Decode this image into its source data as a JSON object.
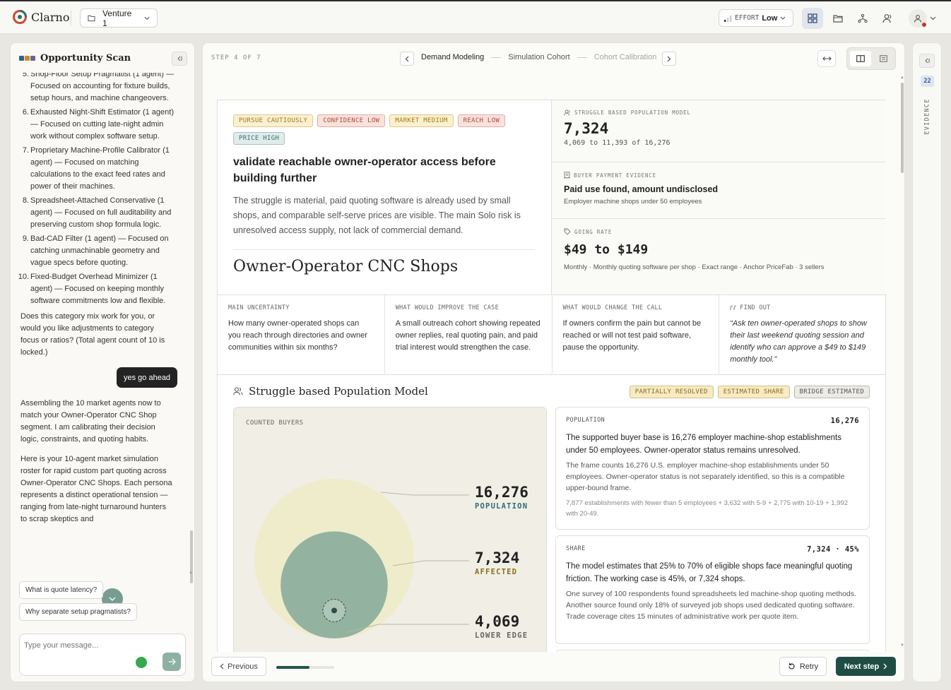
{
  "app": {
    "name": "Clarno",
    "venture": "Venture 1",
    "effort_label": "EFFORT",
    "effort_value": "Low"
  },
  "colors": {
    "accent": "#1f4d44",
    "bubble_population": "#efeccc",
    "bubble_affected": "#93b3a0",
    "chart_bg": "#f1eee5"
  },
  "left_panel": {
    "title": "Opportunity Scan",
    "list": [
      {
        "n": "5.",
        "text": "Shop-Floor Setup Pragmatist (1 agent) — Focused on accounting for fixture builds, setup hours, and machine changeovers."
      },
      {
        "n": "6.",
        "text": "Exhausted Night-Shift Estimator (1 agent) — Focused on cutting late-night admin work without complex software setup."
      },
      {
        "n": "7.",
        "text": "Proprietary Machine-Profile Calibrator (1 agent) — Focused on matching calculations to the exact feed rates and power of their machines."
      },
      {
        "n": "8.",
        "text": "Spreadsheet-Attached Conservative (1 agent) — Focused on full auditability and preserving custom shop formula logic."
      },
      {
        "n": "9.",
        "text": "Bad-CAD Filter (1 agent) — Focused on catching unmachinable geometry and vague specs before quoting."
      },
      {
        "n": "10.",
        "text": "Fixed-Budget Overhead Minimizer (1 agent) — Focused on keeping monthly software commitments low and flexible."
      }
    ],
    "question": "Does this category mix work for you, or would you like adjustments to category focus or ratios? (Total agent count of 10 is locked.)",
    "user_message": "yes go ahead",
    "reply1": "Assembling the 10 market agents now to match your Owner-Operator CNC Shop segment. I am calibrating their decision logic, constraints, and quoting habits.",
    "reply2": "Here is your 10-agent market simulation roster for rapid custom part quoting across Owner-Operator CNC Shops. Each persona represents a distinct operational tension — ranging from late-night turnaround hunters to scrap skeptics and",
    "chips": [
      "What is quote latency?",
      "Why separate setup pragmatists?"
    ],
    "composer_placeholder": "Type your message..."
  },
  "stepper": {
    "step_label": "STEP 4 OF 7",
    "steps": [
      "Demand Modeling",
      "Simulation Cohort",
      "Cohort Calibration"
    ]
  },
  "verdict": {
    "tags": [
      {
        "text": "PURSUE CAUTIOUSLY",
        "color": "#a4791b",
        "bg": "#fbf1cf"
      },
      {
        "text": "CONFIDENCE LOW",
        "color": "#b14a3a",
        "bg": "#f9e2dc"
      },
      {
        "text": "MARKET MEDIUM",
        "color": "#a4791b",
        "bg": "#fbf1cf"
      },
      {
        "text": "REACH LOW",
        "color": "#b14a3a",
        "bg": "#f9e2dc"
      },
      {
        "text": "PRICE HIGH",
        "color": "#3e6e72",
        "bg": "#dfecea"
      }
    ],
    "headline": "validate reachable owner-operator access before building further",
    "body": "The struggle is material, paid quoting software is already used by small shops, and comparable self-serve prices are visible. The main Solo risk is unresolved access supply, not lack of commercial demand.",
    "segment": "Owner-Operator CNC Shops"
  },
  "metrics": {
    "population": {
      "label": "STRUGGLE BASED POPULATION MODEL",
      "value": "7,324",
      "range": "4,069 to 11,393 of 16,276"
    },
    "payment": {
      "label": "BUYER PAYMENT EVIDENCE",
      "headline": "Paid use found, amount undisclosed",
      "sub": "Employer machine shops under 50 employees"
    },
    "rate": {
      "label": "GOING RATE",
      "value": "$49 to $149",
      "sub": "Monthly · Monthly quoting software per shop · Exact range · Anchor PriceFab · 3 sellers"
    }
  },
  "insights": [
    {
      "label": "MAIN UNCERTAINTY",
      "text": "How many owner-operated shops can you reach through directories and owner communities within six months?"
    },
    {
      "label": "WHAT WOULD IMPROVE THE CASE",
      "text": "A small outreach cohort showing repeated owner replies, real quoting pain, and paid trial interest would strengthen the case."
    },
    {
      "label": "WHAT WOULD CHANGE THE CALL",
      "text": "If owners confirm the pain but cannot be reached or will not test paid software, pause the opportunity."
    },
    {
      "label": "FIND OUT",
      "text": "“Ask ten owner-operated shops to show their last weekend quoting session and identify who can approve a $49 to $149 monthly tool.”"
    }
  ],
  "population_model": {
    "title": "Struggle based Population Model",
    "tags": [
      {
        "text": "PARTIALLY RESOLVED",
        "color": "#8c6a17",
        "bg": "#f6ebc4"
      },
      {
        "text": "ESTIMATED SHARE",
        "color": "#8c6a17",
        "bg": "#f6ebc4"
      },
      {
        "text": "BRIDGE ESTIMATED",
        "color": "#555555",
        "bg": "#ecebe5"
      }
    ],
    "chart_label": "COUNTED BUYERS",
    "cards": [
      {
        "label": "POPULATION",
        "value": "16,276",
        "p1": "The supported buyer base is 16,276 employer machine-shop establishments under 50 employees. Owner-operator status remains unresolved.",
        "p2": "The frame counts 16,276 U.S. employer machine-shop establishments under 50 employees. Owner-operator status is not separately identified, so this is a compatible upper-bound frame.",
        "p3": "7,877 establishments with fewer than 5 employees + 3,632 with 5-9 + 2,775 with 10-19 + 1,992 with 20-49."
      },
      {
        "label": "SHARE",
        "value": "7,324 · 45%",
        "p1": "The model estimates that 25% to 70% of eligible shops face meaningful quoting friction. The working case is 45%, or 7,324 shops.",
        "p2": "One survey of 100 respondents found spreadsheets led machine-shop quoting methods. Another source found only 18% of surveyed job shops used dedicated quoting software. Trade coverage cites 15 minutes of administrative work per quote item.",
        "p3": ""
      }
    ]
  },
  "chart_data": {
    "type": "bubble",
    "title": "COUNTED BUYERS",
    "series": [
      {
        "name": "POPULATION",
        "value": 16276,
        "display": "16,276"
      },
      {
        "name": "AFFECTED",
        "value": 7324,
        "display": "7,324"
      },
      {
        "name": "LOWER EDGE",
        "value": 4069,
        "display": "4,069"
      }
    ]
  },
  "bottom": {
    "previous": "Previous",
    "retry": "Retry",
    "next": "Next step",
    "progress": 0.57
  },
  "rail": {
    "count": "22",
    "label": "EVIDENCE"
  }
}
